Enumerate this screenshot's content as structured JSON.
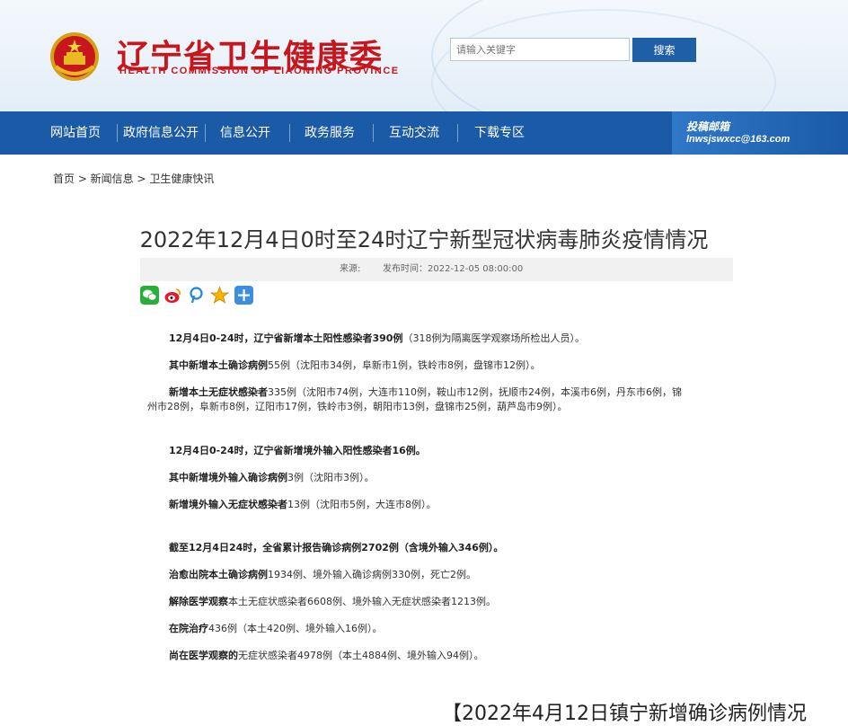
{
  "header": {
    "title_cn": "辽宁省卫生健康委",
    "title_en": "HEALTH COMMISSION OF LIAONING PROVINCE",
    "search_placeholder": "请输入关键字",
    "search_button": "搜索"
  },
  "nav": {
    "items": [
      "网站首页",
      "政府信息公开",
      "信息公开",
      "政务服务",
      "互动交流",
      "下载专区"
    ],
    "mailbox_label": "投稿邮箱",
    "mailbox_email": "lnwsjswxcc@163.com"
  },
  "breadcrumb": "首页 > 新闻信息 > 卫生健康快讯",
  "article": {
    "title": "2022年12月4日0时至24时辽宁新型冠状病毒肺炎疫情情况",
    "source_label": "来源:",
    "published": "发布时间：2022-12-05 08:00:00",
    "p1_bold": "12月4日0-24时，辽宁省新增本土阳性感染者390例",
    "p1_rest": "（318例为隔离医学观察场所检出人员）。",
    "p2_bold": "其中新增本土确诊病例",
    "p2_rest": "55例（沈阳市34例，阜新市1例，铁岭市8例，盘锦市12例）。",
    "p3_bold": "新增本土无症状感染者",
    "p3_rest": "335例（沈阳市74例，大连市110例，鞍山市12例，抚顺市24例，本溪市6例，丹东市6例，锦",
    "p3_line2": "州市28例，阜新市8例，辽阳市17例，铁岭市3例，朝阳市13例，盘锦市25例，葫芦岛市9例）。",
    "p4_bold": "12月4日0-24时，辽宁省新增境外输入阳性感染者16例。",
    "p5_bold": "其中新增境外输入确诊病例",
    "p5_rest": "3例（沈阳市3例）。",
    "p6_bold": "新增境外输入无症状感染者",
    "p6_rest": "13例（沈阳市5例，大连市8例）。",
    "p7_bold": "截至12月4日24时，全省累计报告确诊病例2702例（含境外输入346例）。",
    "p8_bold": "治愈出院本土确诊病例",
    "p8_rest": "1934例、境外输入确诊病例330例，死亡2例。",
    "p9_bold": "解除医学观察",
    "p9_rest": "本土无症状感染者6608例、境外输入无症状感染者1213例。",
    "p10_bold": "在院治疗",
    "p10_rest": "436例（本土420例、境外输入16例）。",
    "p11_bold": "尚在医学观察的",
    "p11_rest": "无症状感染者4978例（本土4884例、境外输入94例）。"
  },
  "share_icons": [
    "wechat-icon",
    "weibo-icon",
    "pinterest-icon",
    "favorite-icon",
    "add-icon"
  ],
  "bottom_title": "【2022年4月12日镇宁新增确诊病例情况"
}
